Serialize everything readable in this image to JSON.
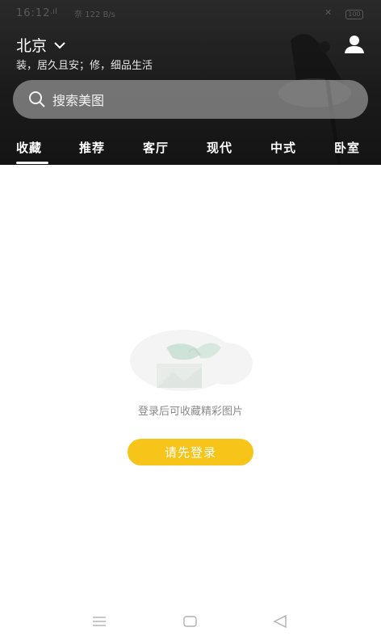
{
  "status_bar": {
    "time": "16:12",
    "network": ".ıl",
    "wifi": "奈 122 B/s",
    "signal": "✕",
    "battery": "100"
  },
  "header": {
    "city": "北京",
    "slogan": "装，居久且安；修，细品生活",
    "user_icon": "user-icon"
  },
  "search": {
    "placeholder": "搜索美图",
    "icon": "search-icon"
  },
  "tabs": [
    "收藏",
    "推荐",
    "客厅",
    "现代",
    "中式",
    "卧室"
  ],
  "active_tab": "收藏",
  "empty_state": {
    "message": "登录后可收藏精彩图片",
    "button": "请先登录",
    "illustration": "empty-collection-illustration"
  },
  "navbar": {
    "items": [
      "menu-icon",
      "home-icon",
      "back-icon"
    ]
  },
  "colors": {
    "header_bg": "#1b1b1b",
    "accent": "#f7c419",
    "muted_text": "#8a8a8a"
  }
}
